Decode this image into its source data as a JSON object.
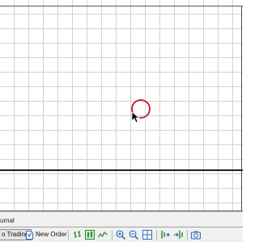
{
  "terminal": {
    "tab_journal": "urnal"
  },
  "toolbar": {
    "autotrading_label": "o Trading",
    "new_order_label": "New Order",
    "icons": [
      "bar-chart-icon",
      "candlestick-chart-icon",
      "line-chart-icon",
      "zoom-in-icon",
      "zoom-out-icon",
      "tile-windows-icon",
      "chart-shift-icon",
      "auto-scroll-icon",
      "screenshot-icon"
    ]
  },
  "colors": {
    "grid": "#d3d3d3",
    "click_marker": "#c8283c",
    "toolbar_bg": "#f0f0f0",
    "icon_green": "#2e8b3a",
    "icon_blue": "#2a6fb6"
  }
}
